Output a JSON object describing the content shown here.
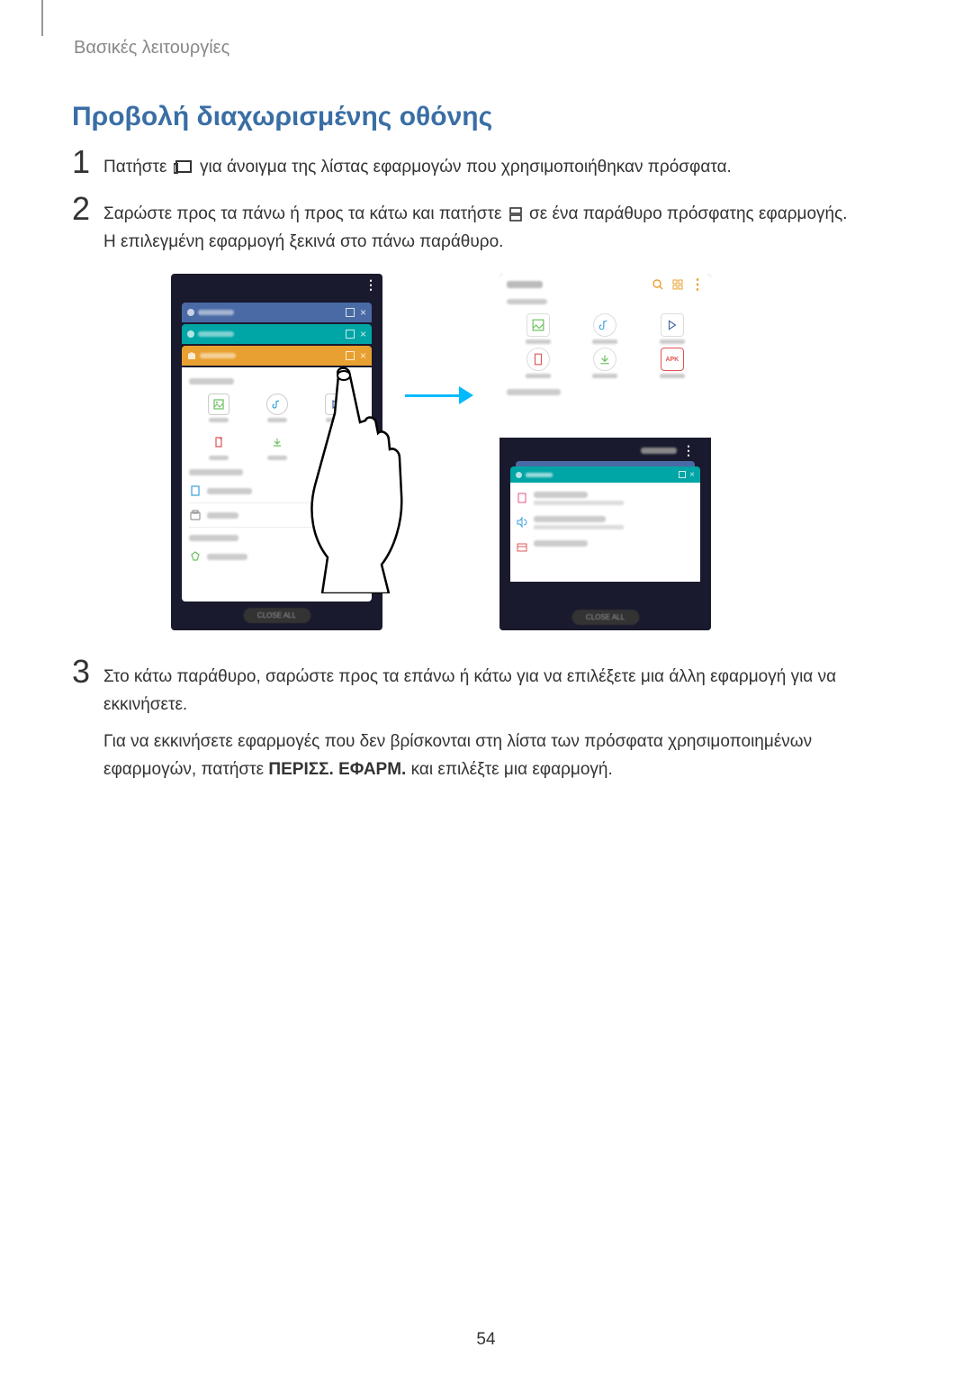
{
  "breadcrumb": "Βασικές λειτουργίες",
  "heading": "Προβολή διαχωρισμένης οθόνης",
  "steps": {
    "s1": {
      "num": "1",
      "pre": "Πατήστε ",
      "post": " για άνοιγμα της λίστας εφαρμογών που χρησιμοποιήθηκαν πρόσφατα."
    },
    "s2": {
      "num": "2",
      "line1_pre": "Σαρώστε προς τα πάνω ή προς τα κάτω και πατήστε ",
      "line1_post": " σε ένα παράθυρο πρόσφατης εφαρμογής.",
      "line2": "Η επιλεγμένη εφαρμογή ξεκινά στο πάνω παράθυρο."
    },
    "s3": {
      "num": "3",
      "text": "Στο κάτω παράθυρο, σαρώστε προς τα επάνω ή κάτω για να επιλέξετε μια άλλη εφαρμογή για να εκκινήσετε."
    }
  },
  "extra": {
    "pre": "Για να εκκινήσετε εφαρμογές που δεν βρίσκονται στη λίστα των πρόσφατα χρησιμοποιημένων εφαρμογών, πατήστε ",
    "bold": "ΠΕΡΙΣΣ. ΕΦΑΡΜ.",
    "post": " και επιλέξτε μια εφαρμογή."
  },
  "figure": {
    "apk_label": "APK",
    "colors": {
      "orange": "#e8a030",
      "teal": "#00a5a5",
      "blue": "#4a6aa5",
      "green": "#6cbf60",
      "cyan": "#3aa0d8",
      "red": "#e05555",
      "pink": "#e05580"
    }
  },
  "page_number": "54"
}
